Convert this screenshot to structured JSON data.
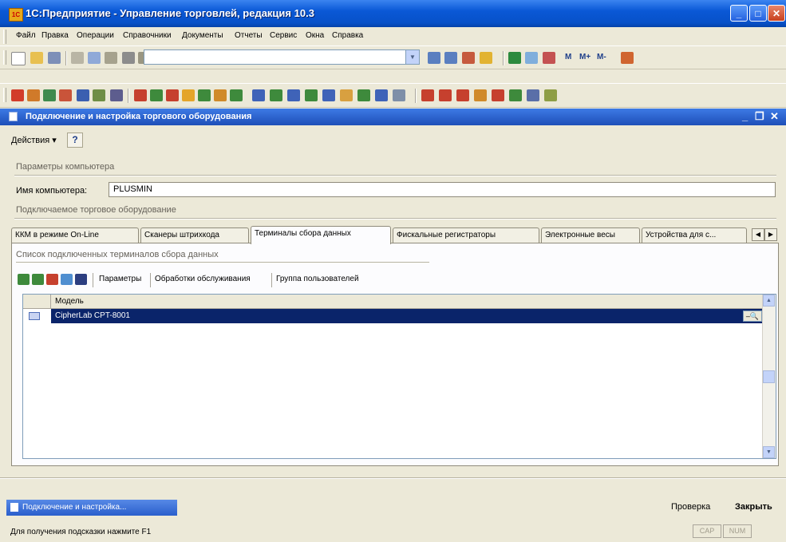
{
  "window": {
    "title": "1С:Предприятие - Управление торговлей, редакция 10.3"
  },
  "menu": [
    "Файл",
    "Правка",
    "Операции",
    "Справочники",
    "Документы",
    "Отчеты",
    "Сервис",
    "Окна",
    "Справка"
  ],
  "toolbar": {
    "search_value": "",
    "m_labels": [
      "M",
      "M+",
      "M-"
    ]
  },
  "child_window": {
    "title": "Подключение и настройка торгового оборудования"
  },
  "actions": {
    "label": "Действия",
    "help": "?"
  },
  "computer_params": {
    "group_title": "Параметры компьютера",
    "name_label": "Имя компьютера:",
    "name_value": "PLUSMIN"
  },
  "equipment": {
    "group_title": "Подключаемое торговое оборудование",
    "tabs": [
      "ККМ в режиме On-Line",
      "Сканеры штрихкода",
      "Терминалы сбора данных",
      "Фискальные регистраторы",
      "Электронные весы",
      "Устройства для с..."
    ],
    "active_tab": 2
  },
  "terminals": {
    "list_title": "Список подключенных терминалов сбора данных",
    "buttons": [
      "Параметры",
      "Обработки обслуживания",
      "Группа пользователей"
    ],
    "column_model": "Модель",
    "rows": [
      {
        "model": "CipherLab CPT-8001"
      }
    ]
  },
  "bottom": {
    "check": "Проверка",
    "close": "Закрыть"
  },
  "taskbar": {
    "item": "Подключение и настройка..."
  },
  "status": {
    "hint": "Для получения подсказки нажмите F1",
    "cap": "CAP",
    "num": "NUM"
  },
  "colors": {
    "titlebar": "#0A58D6",
    "selection": "#0A246A",
    "face": "#ECE9D8"
  }
}
